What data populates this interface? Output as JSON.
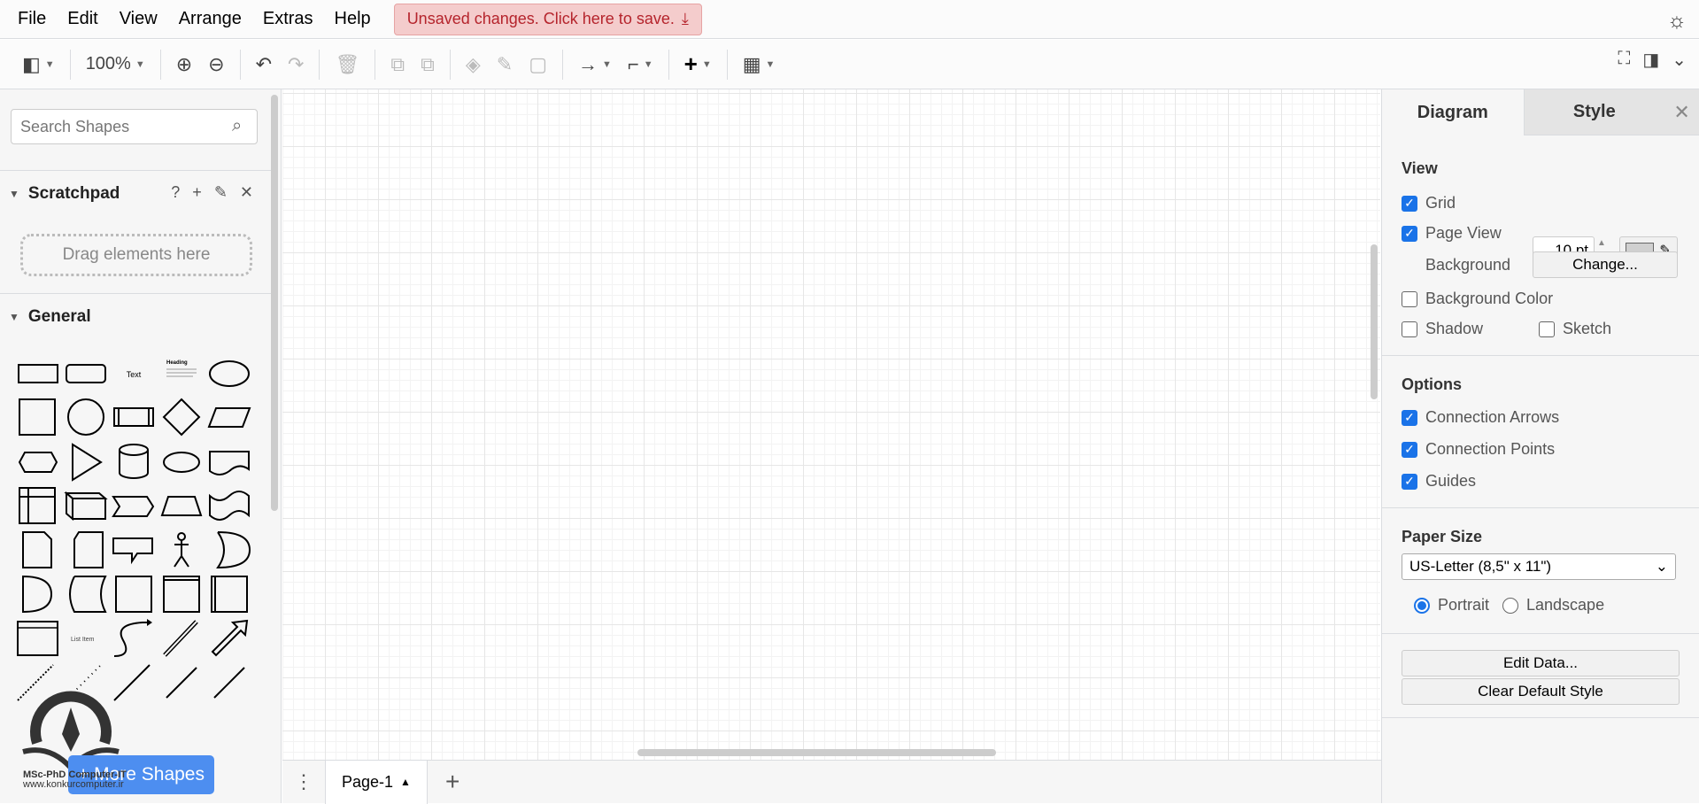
{
  "menubar": {
    "items": [
      "File",
      "Edit",
      "View",
      "Arrange",
      "Extras",
      "Help"
    ],
    "unsaved": "Unsaved changes. Click here to save.",
    "theme_icon": "sun-icon"
  },
  "toolbar": {
    "zoom": "100%"
  },
  "left": {
    "search_placeholder": "Search Shapes",
    "scratchpad": "Scratchpad",
    "scratchpad_icons": [
      "?",
      "+",
      "✎",
      "✕"
    ],
    "drop_hint": "Drag elements here",
    "general": "General",
    "text_shape": "Text",
    "heading_shape": "Heading",
    "list_item_shape": "List Item",
    "more_shapes": "+ More Shapes",
    "watermark": [
      "MSc-PhD Computer-IT",
      "www.konkurcomputer.ir"
    ]
  },
  "bottom": {
    "page_tab": "Page-1"
  },
  "right": {
    "tabs": [
      "Diagram",
      "Style"
    ],
    "view": {
      "title": "View",
      "grid": "Grid",
      "grid_size": "10 pt",
      "page_view": "Page View",
      "background": "Background",
      "change": "Change...",
      "background_color": "Background Color",
      "shadow": "Shadow",
      "sketch": "Sketch"
    },
    "options": {
      "title": "Options",
      "connection_arrows": "Connection Arrows",
      "connection_points": "Connection Points",
      "guides": "Guides"
    },
    "paper": {
      "title": "Paper Size",
      "size": "US-Letter (8,5\" x 11\")",
      "portrait": "Portrait",
      "landscape": "Landscape"
    },
    "edit_data": "Edit Data...",
    "clear_style": "Clear Default Style"
  },
  "colors": {
    "accent": "#1a73e8",
    "unsaved_bg": "#f4cccc",
    "unsaved_text": "#b5242c",
    "more_shapes": "#4d8ef0"
  }
}
